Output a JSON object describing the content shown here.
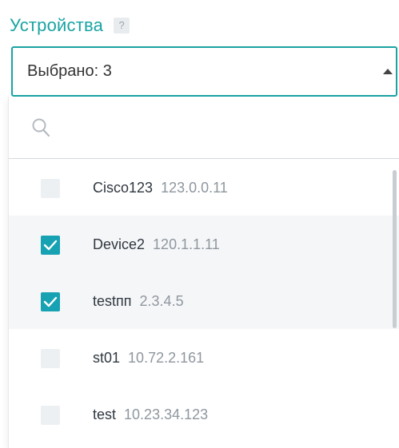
{
  "field": {
    "label": "Устройства",
    "help": "?"
  },
  "select": {
    "value": "Выбрано: 3"
  },
  "search": {
    "placeholder": "",
    "value": ""
  },
  "options": [
    {
      "name": "Cisco123",
      "ip": "123.0.0.11",
      "checked": false
    },
    {
      "name": "Device2",
      "ip": "120.1.1.11",
      "checked": true
    },
    {
      "name": "testпп",
      "ip": "2.3.4.5",
      "checked": true
    },
    {
      "name": "st01",
      "ip": "10.72.2.161",
      "checked": false
    },
    {
      "name": "test",
      "ip": "10.23.34.123",
      "checked": false
    }
  ],
  "colors": {
    "accent": "#1aa3a3",
    "checkbox_checked": "#17a2b3",
    "checkbox_unchecked": "#edf0f2",
    "row_highlight": "#f5f6f8"
  },
  "icons": {
    "help": "question-mark-badge",
    "caret": "caret-up",
    "search": "magnifier",
    "check": "checkmark"
  }
}
